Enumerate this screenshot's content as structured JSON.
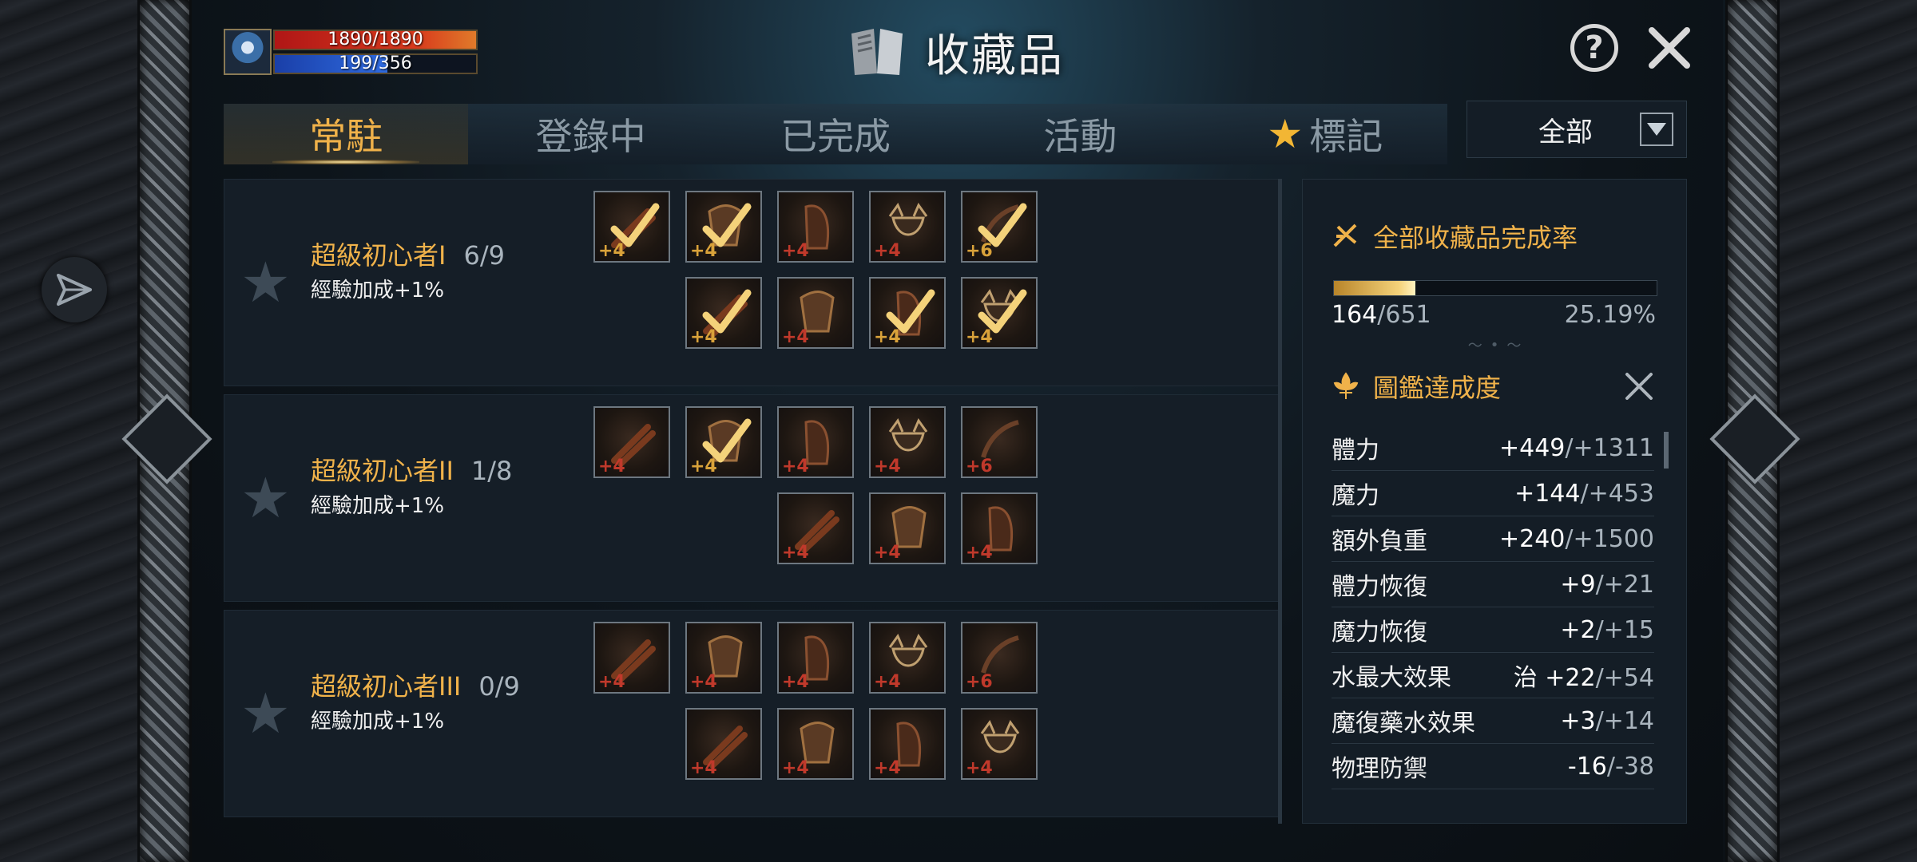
{
  "hud": {
    "hp": "1890/1890",
    "mp": "199/356",
    "mp_fraction": 0.56
  },
  "header": {
    "title": "收藏品"
  },
  "tabs": [
    {
      "label": "常駐",
      "active": true
    },
    {
      "label": "登錄中"
    },
    {
      "label": "已完成"
    },
    {
      "label": "活動"
    },
    {
      "label": "標記",
      "icon": "star-icon"
    }
  ],
  "filter": {
    "label": "全部"
  },
  "collections": [
    {
      "name": "超級初心者I",
      "count": "6/9",
      "bonus": "經驗加成+1%",
      "items": [
        "+4",
        "+4",
        "+4",
        "+4",
        "+6",
        "+4",
        "+4",
        "+4",
        "+4"
      ]
    },
    {
      "name": "超級初心者II",
      "count": "1/8",
      "bonus": "經驗加成+1%",
      "items": [
        "+4",
        "+4",
        "+4",
        "+4",
        "+6",
        "+4",
        "+4",
        "+4"
      ]
    },
    {
      "name": "超級初心者III",
      "count": "0/9",
      "bonus": "經驗加成+1%",
      "items": [
        "+4",
        "+4",
        "+4",
        "+4",
        "+6",
        "+4",
        "+4",
        "+4",
        "+4"
      ]
    }
  ],
  "panel": {
    "completion_title": "全部收藏品完成率",
    "collected": "164",
    "total": "/651",
    "percent": "25.19%",
    "progress_fraction": 0.2519,
    "codex_title": "圖鑑達成度",
    "stats": [
      {
        "label": "體力",
        "value": "+449",
        "max": "/+1311"
      },
      {
        "label": "魔力",
        "value": "+144",
        "max": "/+453"
      },
      {
        "label": "額外負重",
        "value": "+240",
        "max": "/+1500"
      },
      {
        "label": "體力恢復",
        "value": "+9",
        "max": "/+21"
      },
      {
        "label": "魔力恢復",
        "value": "+2",
        "max": "/+15"
      },
      {
        "label": "水最大效果",
        "value": "治 +22",
        "max": "/+54"
      },
      {
        "label": "魔復藥水效果",
        "value": "+3",
        "max": "/+14"
      },
      {
        "label": "物理防禦",
        "value": "-16",
        "max": "/-38"
      }
    ]
  },
  "colors": {
    "accent": "#f0b24a",
    "hp": "#d83a1c",
    "mp": "#2f6be0",
    "bonus_red": "#c0392b"
  }
}
